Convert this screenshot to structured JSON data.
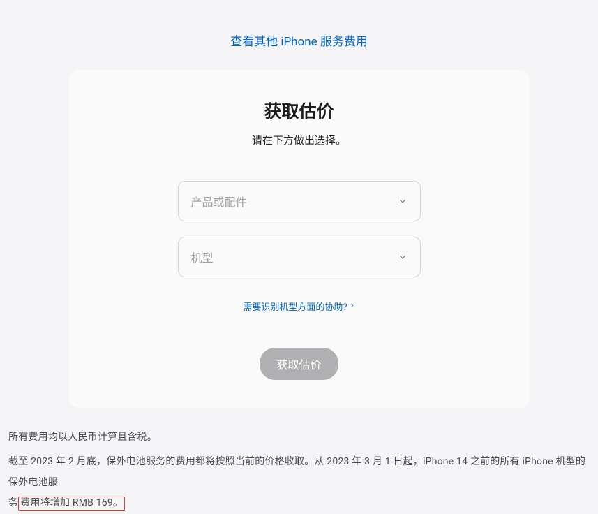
{
  "top_link": "查看其他 iPhone 服务费用",
  "card": {
    "title": "获取估价",
    "subtitle": "请在下方做出选择。",
    "select_product_placeholder": "产品或配件",
    "select_model_placeholder": "机型",
    "help_link": "需要识别机型方面的协助?",
    "submit": "获取估价"
  },
  "footer": {
    "line1": "所有费用均以人民币计算且含税。",
    "line2_part1": "截至 2023 年 2 月底，保外电池服务的费用都将按照当前的价格收取。从 2023 年 3 月 1 日起，iPhone 14 之前的所有 iPhone 机型的保外电池服",
    "line2_part2_pre": "务",
    "line2_highlight": "费用将增加 RMB 169。"
  }
}
